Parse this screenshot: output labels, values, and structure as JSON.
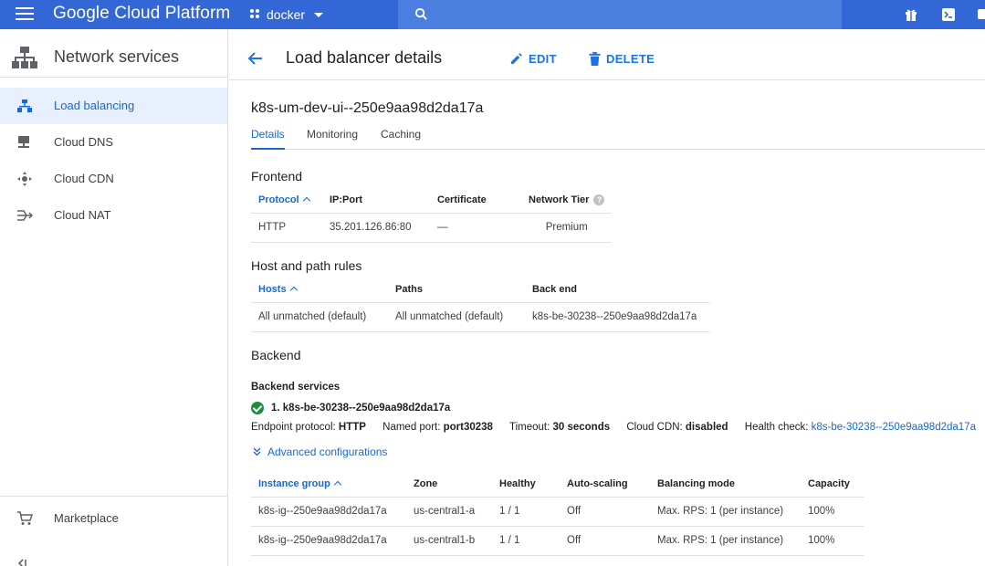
{
  "topbar": {
    "brand": "Google Cloud Platform",
    "project": "docker"
  },
  "sidebar": {
    "title": "Network services",
    "items": [
      {
        "label": "Load balancing"
      },
      {
        "label": "Cloud DNS"
      },
      {
        "label": "Cloud CDN"
      },
      {
        "label": "Cloud NAT"
      }
    ],
    "marketplace": "Marketplace"
  },
  "page": {
    "title": "Load balancer details",
    "edit": "EDIT",
    "delete": "DELETE",
    "lb_name": "k8s-um-dev-ui--250e9aa98d2da17a",
    "tabs": [
      {
        "label": "Details"
      },
      {
        "label": "Monitoring"
      },
      {
        "label": "Caching"
      }
    ]
  },
  "frontend": {
    "title": "Frontend",
    "columns": [
      "Protocol",
      "IP:Port",
      "Certificate",
      "Network Tier"
    ],
    "rows": [
      [
        "HTTP",
        "35.201.126.86:80",
        "—",
        "Premium"
      ]
    ]
  },
  "hostpath": {
    "title": "Host and path rules",
    "columns": [
      "Hosts",
      "Paths",
      "Back end"
    ],
    "rows": [
      [
        "All unmatched (default)",
        "All unmatched (default)",
        "k8s-be-30238--250e9aa98d2da17a"
      ]
    ]
  },
  "backend": {
    "title": "Backend",
    "services_title": "Backend services",
    "service_name": "1. k8s-be-30238--250e9aa98d2da17a",
    "endpoint_label": "Endpoint protocol:",
    "endpoint_value": "HTTP",
    "port_label": "Named port:",
    "port_value": "port30238",
    "timeout_label": "Timeout:",
    "timeout_value": "30 seconds",
    "cdn_label": "Cloud CDN:",
    "cdn_value": "disabled",
    "health_label": "Health check:",
    "health_value": "k8s-be-30238--250e9aa98d2da17a",
    "advanced": "Advanced configurations",
    "columns": [
      "Instance group",
      "Zone",
      "Healthy",
      "Auto-scaling",
      "Balancing mode",
      "Capacity"
    ],
    "rows": [
      [
        "k8s-ig--250e9aa98d2da17a",
        "us-central1-a",
        "1 / 1",
        "Off",
        "Max. RPS: 1 (per instance)",
        "100%"
      ],
      [
        "k8s-ig--250e9aa98d2da17a",
        "us-central1-b",
        "1 / 1",
        "Off",
        "Max. RPS: 1 (per instance)",
        "100%"
      ]
    ]
  },
  "colors": {
    "topbar": "#3367d6",
    "accent": "#1967d2",
    "healthy": "#1e8e3e"
  }
}
